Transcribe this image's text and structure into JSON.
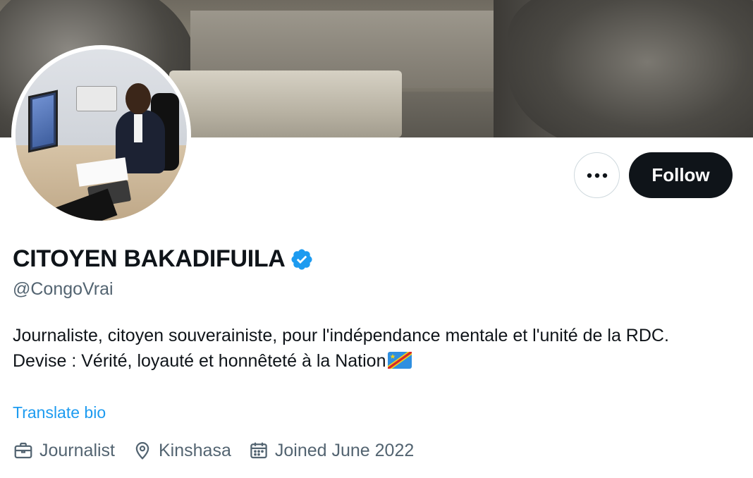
{
  "profile": {
    "display_name": "CITOYEN BAKADIFUILA",
    "handle": "@CongoVrai",
    "verified_icon": "verified-badge-icon",
    "bio_line1": "Journaliste, citoyen souverainiste, pour l'indépendance mentale et l'unité de la RDC.",
    "bio_line2": "Devise : Vérité, loyauté et honnêteté à la Nation",
    "translate_label": "Translate bio",
    "profession": "Journalist",
    "location": "Kinshasa",
    "joined": "Joined June 2022"
  },
  "actions": {
    "more_icon": "more-options-icon",
    "follow_label": "Follow"
  },
  "colors": {
    "accent": "#1d9bf0",
    "text_primary": "#0f1419",
    "text_secondary": "#536471",
    "follow_bg": "#0f1419"
  }
}
